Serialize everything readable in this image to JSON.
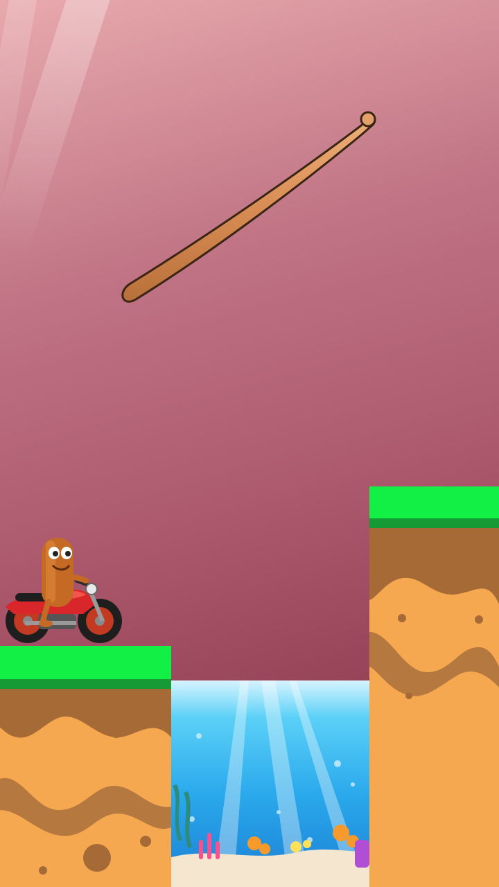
{
  "game": {
    "title": "",
    "scene": "draw-bridge-bike-puzzle"
  },
  "player": {
    "character": "sausage-rider-character",
    "vehicle": "red-motorcycle"
  },
  "drawn_stick": {
    "icon": "drawn-wooden-stick"
  },
  "colors": {
    "sky_top": "#e8a9ad",
    "sky_bottom": "#7d2a44",
    "grass": "#12f046",
    "grass_dark": "#169a36",
    "soil": "#f5a84f",
    "soil_dark": "#a56a35",
    "water": "#2aa9ec",
    "stick": "#d88c53",
    "bike": "#d8262a"
  }
}
